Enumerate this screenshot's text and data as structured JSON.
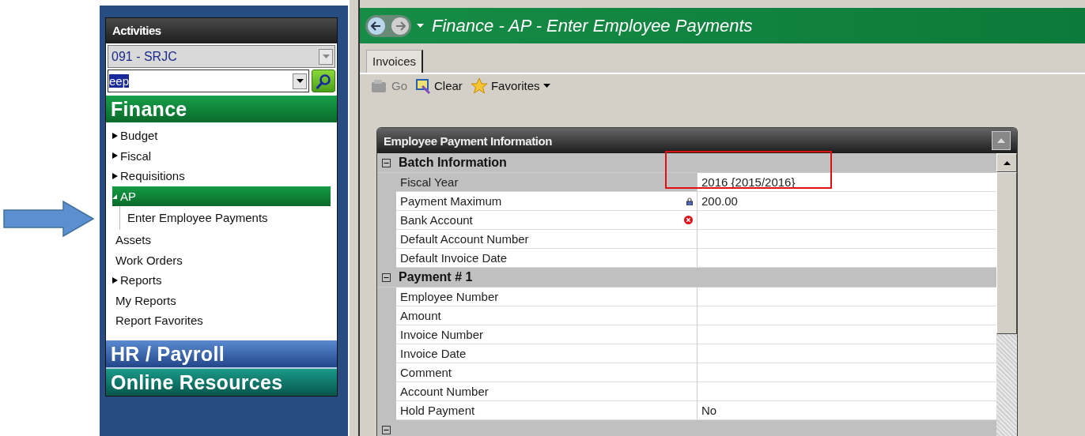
{
  "sidebar": {
    "title": "Activities",
    "district": {
      "value": "091 - SRJC"
    },
    "search": {
      "value": "eep"
    },
    "modules": [
      {
        "label": "Finance",
        "kind": "finance",
        "items": [
          {
            "label": "Budget",
            "kind": "folder",
            "expanded": false,
            "selected": false
          },
          {
            "label": "Fiscal",
            "kind": "folder",
            "expanded": false,
            "selected": false
          },
          {
            "label": "Requisitions",
            "kind": "folder",
            "expanded": false,
            "selected": false
          },
          {
            "label": "AP",
            "kind": "folder",
            "expanded": true,
            "selected": true,
            "children": [
              {
                "label": "Enter Employee Payments",
                "selected": false
              }
            ]
          },
          {
            "label": "Assets",
            "kind": "link",
            "selected": false
          },
          {
            "label": "Work Orders",
            "kind": "link",
            "selected": false
          },
          {
            "label": "Reports",
            "kind": "folder",
            "expanded": false,
            "selected": false
          },
          {
            "label": "My Reports",
            "kind": "link",
            "selected": false
          },
          {
            "label": "Report Favorites",
            "kind": "link",
            "selected": false
          }
        ]
      },
      {
        "label": "HR / Payroll",
        "kind": "hr"
      },
      {
        "label": "Online Resources",
        "kind": "online"
      }
    ]
  },
  "main": {
    "title": "Finance - AP - Enter Employee Payments",
    "tabs": [
      {
        "label": "Invoices",
        "selected": true
      }
    ],
    "toolbar": [
      {
        "label": "Go",
        "kind": "go",
        "disabled": true
      },
      {
        "label": "Clear",
        "kind": "clear",
        "disabled": false
      },
      {
        "label": "Favorites",
        "kind": "favorites",
        "disabled": false
      }
    ],
    "panel": {
      "title": "Employee Payment Information",
      "sections": [
        {
          "label": "Batch Information",
          "expanded": true,
          "rows": [
            {
              "label": "Fiscal Year",
              "value": "2016 {2015/2016}",
              "kind": "plain",
              "selected": true,
              "highlighted": true
            },
            {
              "label": "Payment Maximum",
              "value": "200.00",
              "kind": "locked",
              "selected": false,
              "highlighted": false
            },
            {
              "label": "Bank Account",
              "kind": "required",
              "selected": false,
              "highlighted": false
            },
            {
              "label": "Default Account Number",
              "selected": false,
              "highlighted": false
            },
            {
              "label": "Default Invoice Date",
              "selected": false,
              "highlighted": false
            }
          ]
        },
        {
          "label": "Payment # 1",
          "expanded": true,
          "rows": [
            {
              "label": "Employee Number",
              "selected": false,
              "highlighted": false
            },
            {
              "label": "Amount",
              "selected": false,
              "highlighted": false
            },
            {
              "label": "Invoice Number",
              "selected": false,
              "highlighted": false
            },
            {
              "label": "Invoice Date",
              "selected": false,
              "highlighted": false
            },
            {
              "label": "Comment",
              "selected": false,
              "highlighted": false
            },
            {
              "label": "Account Number",
              "selected": false,
              "highlighted": false
            },
            {
              "label": "Hold Payment",
              "value": "No",
              "selected": false,
              "highlighted": false
            }
          ]
        },
        {
          "expanded": true
        }
      ]
    }
  }
}
